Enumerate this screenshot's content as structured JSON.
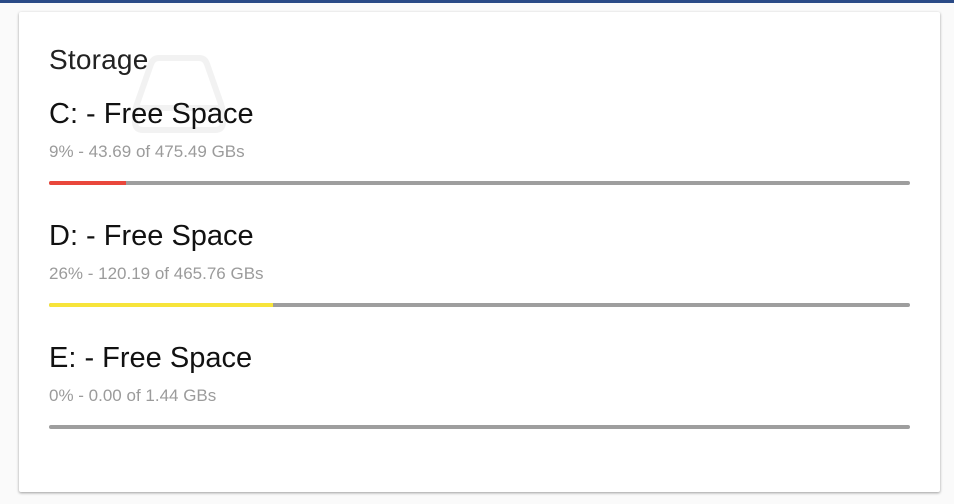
{
  "card": {
    "title": "Storage"
  },
  "icons": {
    "background": "hard-drive-icon"
  },
  "drives": [
    {
      "title": "C: - Free Space",
      "subtitle": "9% - 43.69 of 475.49 GBs",
      "percent_free": 9,
      "bar_color": "#e9473b"
    },
    {
      "title": "D: - Free Space",
      "subtitle": "26% - 120.19 of 465.76 GBs",
      "percent_free": 26,
      "bar_color": "#f7e43a"
    },
    {
      "title": "E: - Free Space",
      "subtitle": "0% - 0.00 of 1.44 GBs",
      "percent_free": 0,
      "bar_color": "#e9473b"
    }
  ],
  "colors": {
    "track": "#9e9e9e",
    "accent_topbar": "#2a4a86"
  }
}
